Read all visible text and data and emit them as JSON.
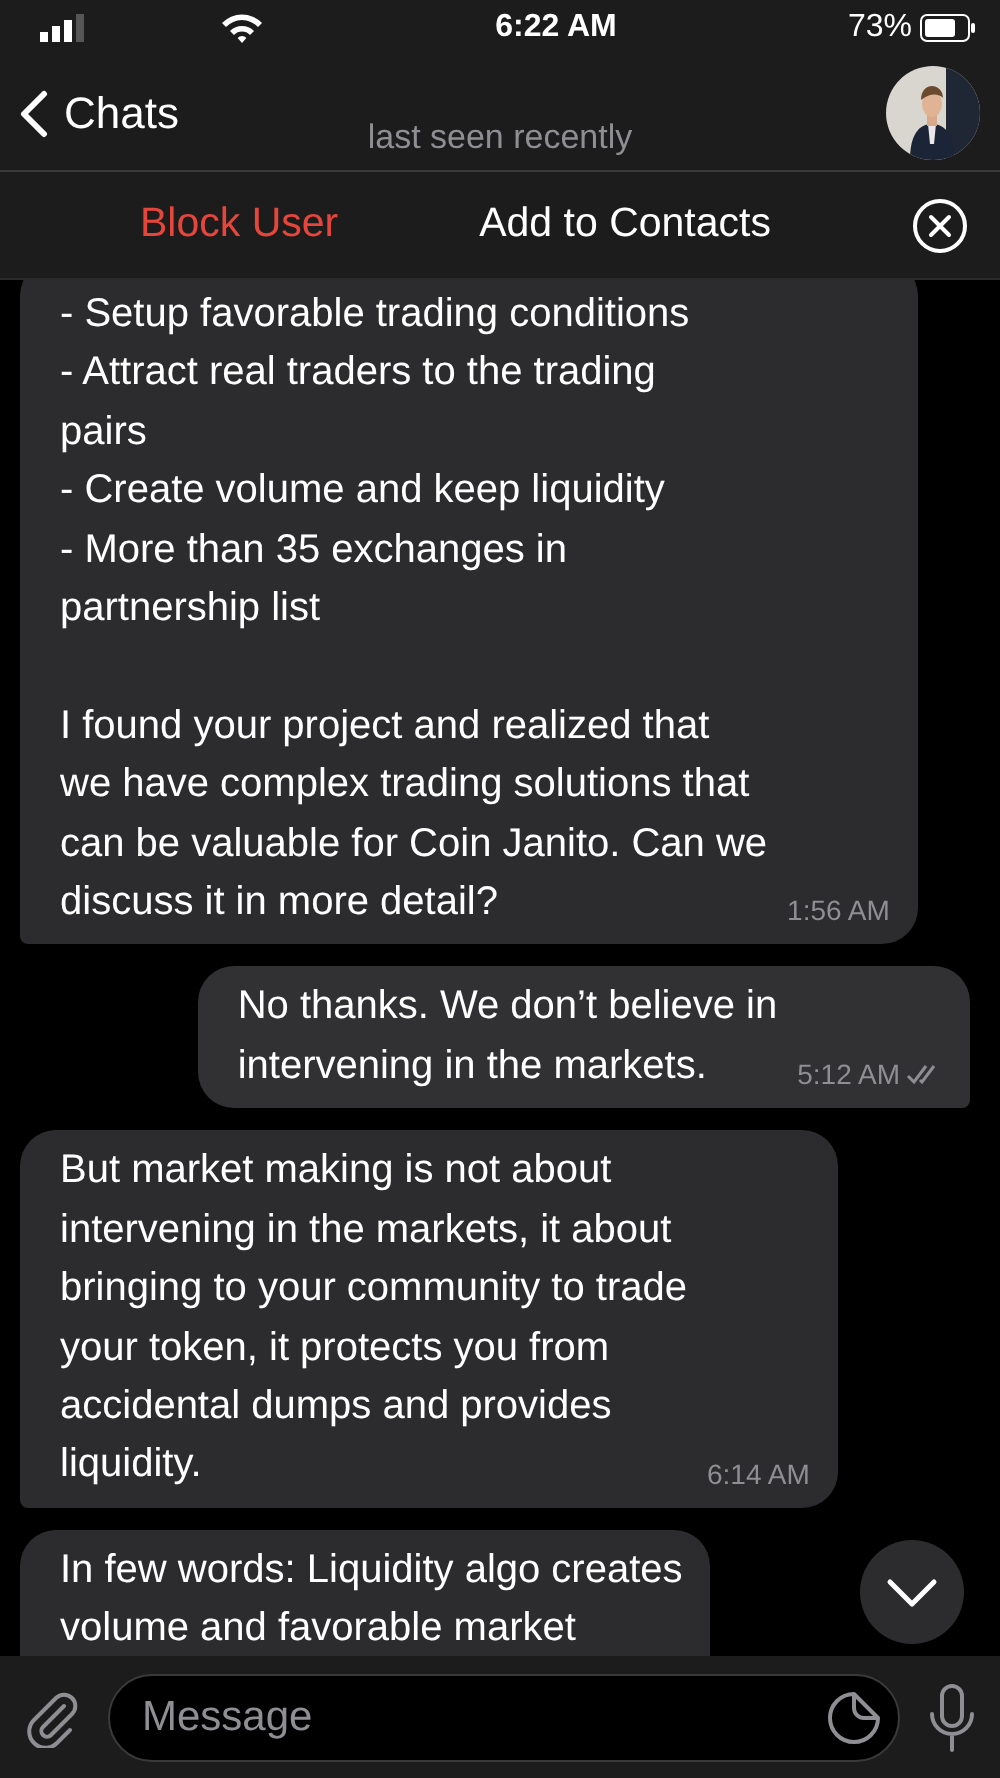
{
  "status_bar": {
    "time": "6:22 AM",
    "battery": "73%"
  },
  "header": {
    "back_label": "Chats",
    "subtitle": "last seen recently"
  },
  "action_bar": {
    "block_label": "Block User",
    "add_label": "Add to Contacts"
  },
  "messages": [
    {
      "outgoing": false,
      "text": "- Setup favorable trading conditions\n- Attract real traders to the trading\npairs\n- Create volume and keep liquidity\n- More than 35 exchanges in\npartnership list\n\nI found your project and realized that\nwe have complex trading solutions that\ncan be valuable for Coin Janito. Can we\ndiscuss it in more detail?",
      "time": "1:56 AM"
    },
    {
      "outgoing": true,
      "read": true,
      "text": "No thanks. We don’t believe in\nintervening in the markets.",
      "time": "5:12 AM"
    },
    {
      "outgoing": false,
      "text": "But market making is not about\nintervening in the markets, it about\nbringing to your community to trade\nyour token, it protects you from\naccidental dumps and provides\nliquidity.",
      "time": "6:14 AM"
    },
    {
      "outgoing": false,
      "text": "In few words: Liquidity algo creates\nvolume and favorable market"
    }
  ],
  "composer": {
    "placeholder": "Message"
  }
}
